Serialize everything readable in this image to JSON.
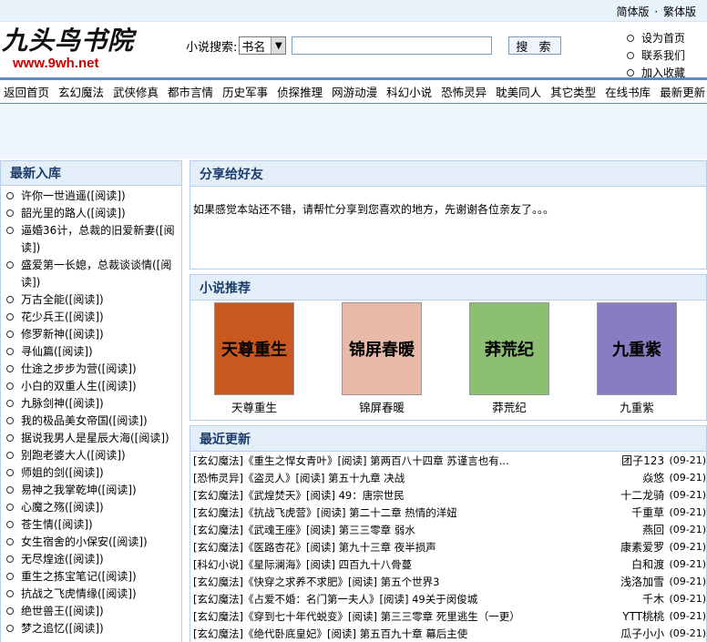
{
  "topbar": {
    "simplified": "简体版",
    "sep": "·",
    "traditional": "繁体版"
  },
  "logo": {
    "name": "九头鸟书院",
    "url": "www.9wh.net"
  },
  "search": {
    "label": "小说搜索:",
    "select_value": "书名",
    "button": "搜 索"
  },
  "toplinks": [
    "设为首页",
    "联系我们",
    "加入收藏"
  ],
  "nav": [
    "返回首页",
    "玄幻魔法",
    "武侠修真",
    "都市言情",
    "历史军事",
    "侦探推理",
    "网游动漫",
    "科幻小说",
    "恐怖灵异",
    "耽美同人",
    "其它类型",
    "在线书库",
    "最新更新"
  ],
  "left": {
    "title": "最新入库",
    "items": [
      "许你一世逍遥([阅读])",
      "韶光里的路人([阅读])",
      "逼婚36计，总裁的旧爱新妻([阅读])",
      "盛爱第一长媳，总裁谈谈情([阅读])",
      "万古全能([阅读])",
      "花少兵王([阅读])",
      "修罗新神([阅读])",
      "寻仙篇([阅读])",
      "仕途之步步为营([阅读])",
      "小白的双重人生([阅读])",
      "九脉剑神([阅读])",
      "我的极品美女帝国([阅读])",
      "据说我男人是星辰大海([阅读])",
      "别跑老婆大人([阅读])",
      "师姐的剑([阅读])",
      "易神之我掌乾坤([阅读])",
      "心魔之殇([阅读])",
      "苍生情([阅读])",
      "女生宿舍的小保安([阅读])",
      "无尽煌途([阅读])",
      "重生之拣宝笔记([阅读])",
      "抗战之飞虎情缘([阅读])",
      "绝世兽王([阅读])",
      "梦之追忆([阅读])"
    ]
  },
  "share": {
    "title": "分享给好友",
    "text": "如果感觉本站还不错，请帮忙分享到您喜欢的地方，先谢谢各位亲友了。。。"
  },
  "recommend": {
    "title": "小说推荐",
    "books": [
      {
        "name": "天尊重生",
        "cover_text": "天尊重生",
        "color": "#c9581e"
      },
      {
        "name": "锦屏春暖",
        "cover_text": "锦屏春暖",
        "color": "#e9b9a8"
      },
      {
        "name": "莽荒纪",
        "cover_text": "莽荒纪",
        "color": "#8dbf73"
      },
      {
        "name": "九重紫",
        "cover_text": "九重紫",
        "color": "#8a7cc2"
      }
    ]
  },
  "recent": {
    "title": "最近更新",
    "rows": [
      {
        "cat": "[玄幻魔法]",
        "text": "《重生之悍女青叶》[阅读] 第两百八十四章 苏谨言也有...",
        "author": "团子123",
        "date": "(09-21)"
      },
      {
        "cat": "[恐怖灵异]",
        "text": "《盗灵人》[阅读] 第五十九章 决战",
        "author": "焱悠",
        "date": "(09-21)"
      },
      {
        "cat": "[玄幻魔法]",
        "text": "《武煌焚天》[阅读] 49：唐宗世民",
        "author": "十二龙骑",
        "date": "(09-21)"
      },
      {
        "cat": "[玄幻魔法]",
        "text": "《抗战飞虎营》[阅读] 第二十二章 热情的洋妞",
        "author": "千重草",
        "date": "(09-21)"
      },
      {
        "cat": "[玄幻魔法]",
        "text": "《武魂王座》[阅读] 第三三零章 弱水",
        "author": "燕回",
        "date": "(09-21)"
      },
      {
        "cat": "[玄幻魔法]",
        "text": "《医路杏花》[阅读] 第九十三章 夜半损声",
        "author": "康素爱罗",
        "date": "(09-21)"
      },
      {
        "cat": "[科幻小说]",
        "text": "《星际澜海》[阅读] 四百九十八骨蔓",
        "author": "白和渡",
        "date": "(09-21)"
      },
      {
        "cat": "[玄幻魔法]",
        "text": "《快穿之求养不求肥》[阅读] 第五个世界3",
        "author": "浅洛加雪",
        "date": "(09-21)"
      },
      {
        "cat": "[玄幻魔法]",
        "text": "《占爱不婚：名门第一夫人》[阅读] 49关于闵俊城",
        "author": "千木",
        "date": "(09-21)"
      },
      {
        "cat": "[玄幻魔法]",
        "text": "《穿到七十年代蜕变》[阅读] 第三三零章 死里逃生（一更）",
        "author": "YTT桃桃",
        "date": "(09-21)"
      },
      {
        "cat": "[玄幻魔法]",
        "text": "《绝代卧底皇妃》[阅读] 第五百九十章 幕后主使",
        "author": "瓜子小小",
        "date": "(09-21)"
      }
    ]
  }
}
